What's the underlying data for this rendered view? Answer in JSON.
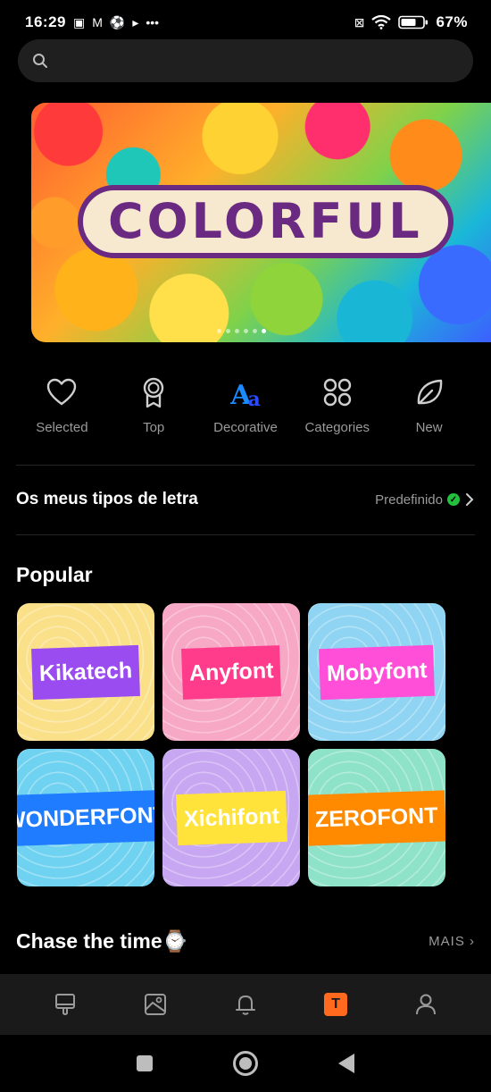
{
  "status_bar": {
    "time": "16:29",
    "left_icons": [
      "sim-icon",
      "gmail-icon",
      "soccer-icon",
      "play-icon",
      "more-dots-icon"
    ],
    "more": "•••",
    "battery": "67%"
  },
  "search": {
    "placeholder": ""
  },
  "banner": {
    "title": "COLORFUL",
    "dots_count": 6,
    "active_dot": 5
  },
  "categories": [
    {
      "label": "Selected",
      "icon": "heart-icon"
    },
    {
      "label": "Top",
      "icon": "medal-icon"
    },
    {
      "label": "Decorative",
      "icon": "decorative-aa-icon",
      "glyph_main": "A",
      "glyph_small": "a"
    },
    {
      "label": "Categories",
      "icon": "grid-clover-icon"
    },
    {
      "label": "New",
      "icon": "leaf-icon"
    }
  ],
  "my_fonts": {
    "title": "Os meus tipos de letra",
    "value": "Predefinido"
  },
  "popular": {
    "title": "Popular",
    "fonts": [
      {
        "name": "Kikatech",
        "bg": "#fbe08a",
        "label_bg": "#9a4cf0",
        "label_color": "#ffffff"
      },
      {
        "name": "Anyfont",
        "bg": "#f7a8c4",
        "label_bg": "#ff3c8c",
        "label_color": "#ffffff"
      },
      {
        "name": "Mobyfont",
        "bg": "#8fd4f2",
        "label_bg": "#ff4fd8",
        "label_color": "#ffffff"
      },
      {
        "name": "WONDERFONT",
        "bg": "#6fd2f0",
        "label_bg": "#1f7cff",
        "label_color": "#ffffff"
      },
      {
        "name": "Xichifont",
        "bg": "#c7a6f2",
        "label_bg": "#ffe23a",
        "label_color": "#ffffff"
      },
      {
        "name": "ZEROFONT",
        "bg": "#8ee2c8",
        "label_bg": "#ff8a00",
        "label_color": "#ffffff"
      }
    ]
  },
  "chase": {
    "title": "Chase the time⌚",
    "more": "MAIS ›"
  },
  "bottom_nav": [
    {
      "icon": "theme-icon"
    },
    {
      "icon": "wallpaper-icon"
    },
    {
      "icon": "bell-icon"
    },
    {
      "icon": "font-icon",
      "label": "T",
      "active": true
    },
    {
      "icon": "profile-icon"
    }
  ]
}
